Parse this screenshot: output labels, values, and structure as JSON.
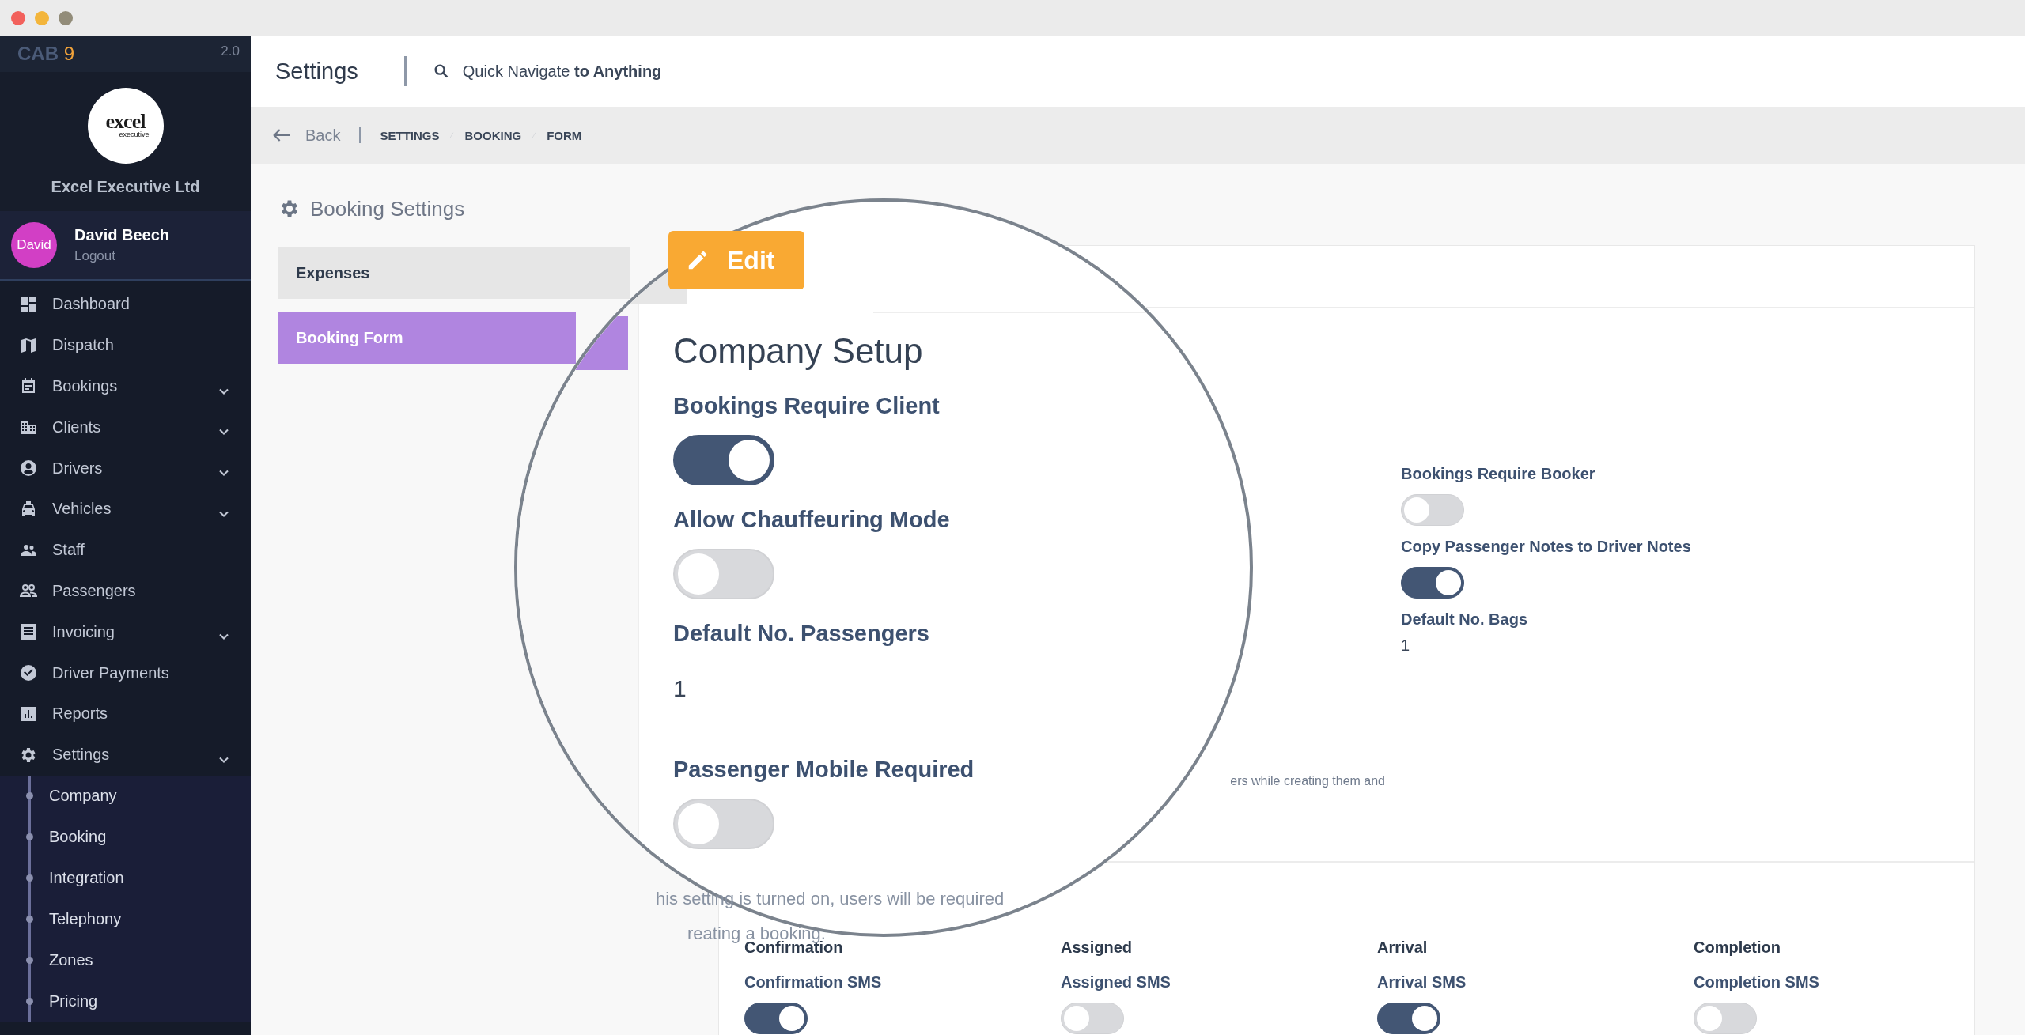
{
  "sidebar": {
    "brand": "CAB",
    "brand_number": "9",
    "version": "2.0",
    "logo_text": "excel",
    "logo_subtext": "executive",
    "company": "Excel Executive Ltd",
    "user": {
      "avatar": "David",
      "name": "David Beech",
      "logout": "Logout"
    },
    "items": [
      {
        "label": "Dashboard",
        "expandable": false
      },
      {
        "label": "Dispatch",
        "expandable": false
      },
      {
        "label": "Bookings",
        "expandable": true
      },
      {
        "label": "Clients",
        "expandable": true
      },
      {
        "label": "Drivers",
        "expandable": true
      },
      {
        "label": "Vehicles",
        "expandable": true
      },
      {
        "label": "Staff",
        "expandable": false
      },
      {
        "label": "Passengers",
        "expandable": false
      },
      {
        "label": "Invoicing",
        "expandable": true
      },
      {
        "label": "Driver Payments",
        "expandable": false
      },
      {
        "label": "Reports",
        "expandable": false
      },
      {
        "label": "Settings",
        "expandable": true,
        "children": [
          {
            "label": "Company"
          },
          {
            "label": "Booking"
          },
          {
            "label": "Integration"
          },
          {
            "label": "Telephony"
          },
          {
            "label": "Zones"
          },
          {
            "label": "Pricing"
          }
        ]
      }
    ]
  },
  "header": {
    "title": "Settings",
    "search": "Quick Navigate **to Anything**"
  },
  "breadcrumb": {
    "back": "Back",
    "crumbs": [
      "SETTINGS",
      "BOOKING",
      "FORM"
    ]
  },
  "page_title": "Booking Settings",
  "tabs": [
    {
      "label": "Expenses",
      "selected": false
    },
    {
      "label": "Booking Form",
      "selected": true
    }
  ],
  "card": {
    "right_settings": [
      {
        "kind": "toggle",
        "label": "Bookings Require Booker",
        "on": false
      },
      {
        "kind": "toggle",
        "label": "Copy Passenger Notes to Driver Notes",
        "on": true
      },
      {
        "kind": "value",
        "label": "Default No. Bags",
        "value": "1"
      }
    ],
    "description_fragment": "ers while creating them and",
    "notifications": [
      {
        "title": "Confirmation",
        "label": "Confirmation SMS",
        "on": true
      },
      {
        "title": "Assigned",
        "label": "Assigned SMS",
        "on": false
      },
      {
        "title": "Arrival",
        "label": "Arrival SMS",
        "on": true
      },
      {
        "title": "Completion",
        "label": "Completion SMS",
        "on": false
      }
    ]
  },
  "magnifier": {
    "edit_button": "Edit",
    "heading": "Company Setup",
    "settings": [
      {
        "kind": "toggle",
        "label": "Bookings Require Client",
        "on": true
      },
      {
        "kind": "toggle",
        "label": "Allow Chauffeuring Mode",
        "on": false
      },
      {
        "kind": "value",
        "label": "Default No. Passengers",
        "value": "1"
      },
      {
        "kind": "toggle",
        "label": "Passenger Mobile Required",
        "on": false
      }
    ],
    "note_lines": [
      "his setting is turned on, users will be required",
      "reating a booking."
    ]
  }
}
